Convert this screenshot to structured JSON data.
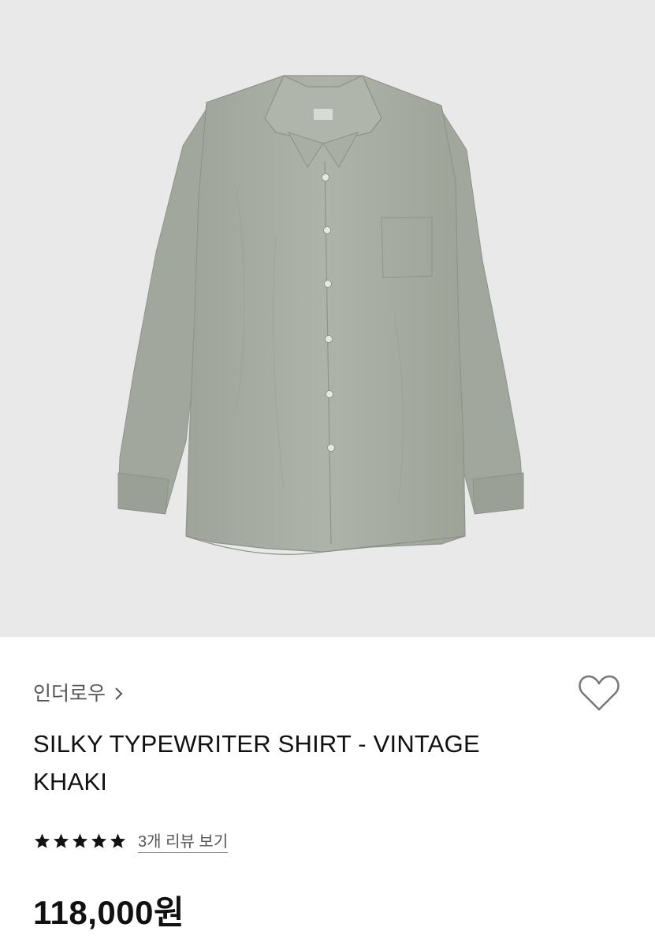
{
  "product": {
    "image_icon": "shirt-photo",
    "brand": "인더로우",
    "brand_chevron_icon": "chevron-right-icon",
    "wishlist_icon": "heart-outline-icon",
    "title": "SILKY TYPEWRITER SHIRT - VINTAGE KHAKI",
    "rating_stars": 5,
    "rating_max": 5,
    "review_link": "3개 리뷰 보기",
    "price": "118,000원"
  },
  "colors": {
    "image_background": "#e9e9ea",
    "shirt": "#a8ada4",
    "text_primary": "#111111",
    "text_secondary": "#555555"
  }
}
